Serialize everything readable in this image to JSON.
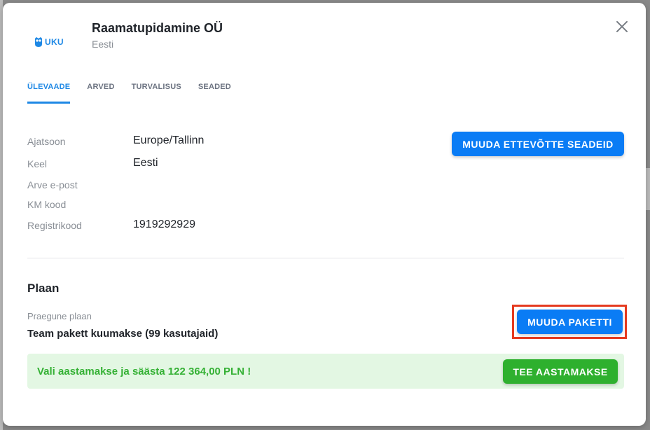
{
  "header": {
    "logo_text": "UKU",
    "company_name": "Raamatupidamine OÜ",
    "country": "Eesti"
  },
  "tabs": [
    {
      "label": "ÜLEVAADE",
      "active": true
    },
    {
      "label": "ARVED",
      "active": false
    },
    {
      "label": "TURVALISUS",
      "active": false
    },
    {
      "label": "SEADED",
      "active": false
    }
  ],
  "details": {
    "timezone_label": "Ajatsoon",
    "timezone_value": "Europe/Tallinn",
    "language_label": "Keel",
    "language_value": "Eesti",
    "invoice_email_label": "Arve e-post",
    "vat_code_label": "KM kood",
    "reg_code_label": "Registrikood",
    "reg_code_value": "1919292929",
    "edit_settings_button": "MUUDA ETTEVÕTTE SEADEID"
  },
  "plan": {
    "title": "Plaan",
    "current_label": "Praegune plaan",
    "current_value": "Team pakett kuumakse (99 kasutajaid)",
    "change_button": "MUUDA PAKETTI",
    "promo_text": "Vali aastamakse ja säästa 122 364,00 PLN !",
    "annual_button": "TEE AASTAMAKSE"
  },
  "colors": {
    "accent": "#0a7cf5",
    "success": "#2eb02e",
    "highlight": "#e53a1f"
  }
}
